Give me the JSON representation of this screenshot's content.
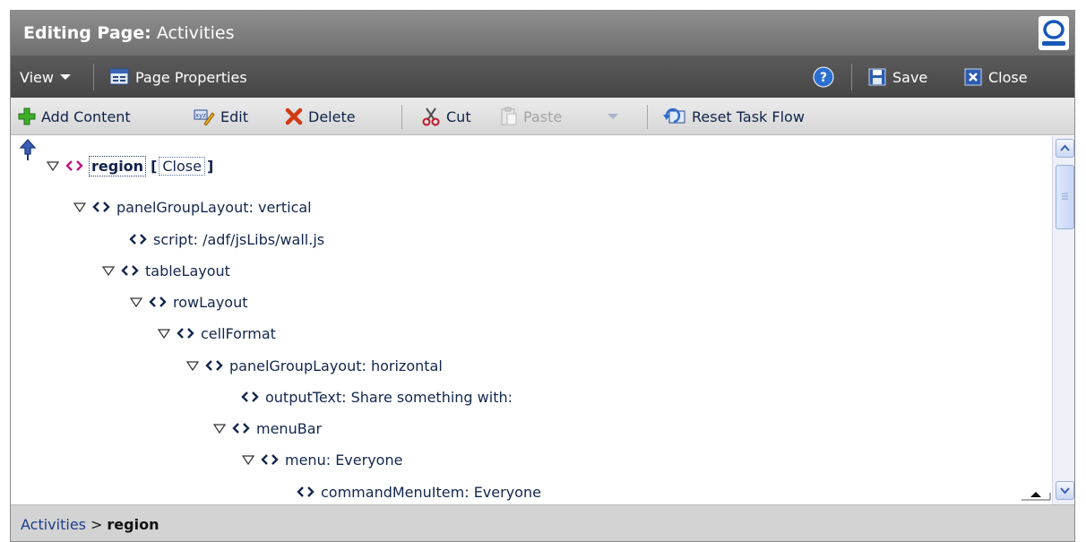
{
  "title": {
    "prefix": "Editing Page:",
    "name": "Activities"
  },
  "menubar": {
    "view_label": "View",
    "page_properties_label": "Page Properties",
    "save_label": "Save",
    "close_label": "Close"
  },
  "toolbar": {
    "add_content": "Add Content",
    "edit": "Edit",
    "delete": "Delete",
    "cut": "Cut",
    "paste": "Paste",
    "reset_task_flow": "Reset Task Flow"
  },
  "tree": {
    "root": {
      "label": "region",
      "open_bracket": "[",
      "close_text": "Close",
      "close_bracket": "]"
    },
    "nodes": [
      "panelGroupLayout: vertical",
      "script: /adf/jsLibs/wall.js",
      "tableLayout",
      "rowLayout",
      "cellFormat",
      "panelGroupLayout: horizontal",
      "outputText: Share something with:",
      "menuBar",
      "menu: Everyone",
      "commandMenuItem: Everyone"
    ]
  },
  "breadcrumb": {
    "parent": "Activities",
    "separator": ">",
    "current": "region"
  },
  "icons": [
    "oracle-logo",
    "chevron-down-icon",
    "page-properties-icon",
    "help-icon",
    "save-icon",
    "close-icon",
    "add-icon",
    "edit-icon",
    "delete-icon",
    "cut-icon",
    "paste-icon",
    "reset-task-flow-icon",
    "up-arrow-icon",
    "expand-triangle-icon",
    "component-tag-icon"
  ],
  "colors": {
    "title_bar": "#7f7f7f",
    "menu_bar": "#505050",
    "toolbar": "#e2e2e2",
    "text_link": "#12264d",
    "footer": "#d3d3d3",
    "region_icon": "#c0187f"
  }
}
